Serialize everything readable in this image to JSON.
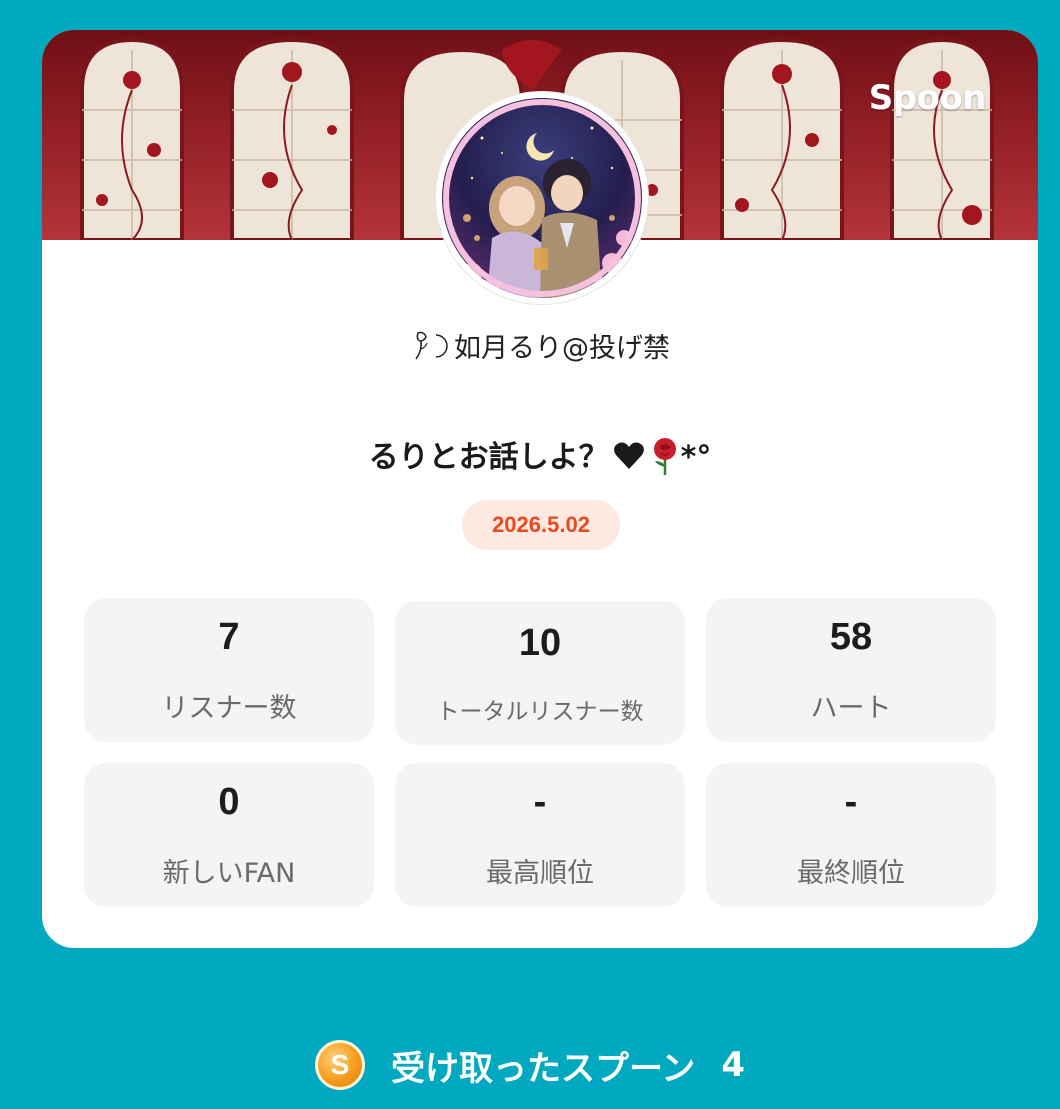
{
  "brand": {
    "logo_text": "Spoon"
  },
  "profile": {
    "username": "如月るり@投げ禁",
    "username_prefix_icon": "rose-moon-icon"
  },
  "live": {
    "title": "るりとお話しよ？",
    "title_suffix": "*°",
    "title_icons": [
      "heart-icon",
      "rose-icon"
    ],
    "date": "2026.5.02"
  },
  "stats": [
    {
      "value": "7",
      "label": "リスナー数"
    },
    {
      "value": "10",
      "label": "トータルリスナー数"
    },
    {
      "value": "58",
      "label": "ハート"
    },
    {
      "value": "0",
      "label": "新しいFAN"
    },
    {
      "value": "-",
      "label": "最高順位"
    },
    {
      "value": "-",
      "label": "最終順位"
    }
  ],
  "footer": {
    "coin_symbol": "S",
    "label": "受け取ったスプーン",
    "count": "4"
  },
  "colors": {
    "background": "#00a8c0",
    "card": "#ffffff",
    "date_text": "#e8491d",
    "date_bg": "#fde8e2",
    "stat_bg": "#f4f4f4"
  }
}
